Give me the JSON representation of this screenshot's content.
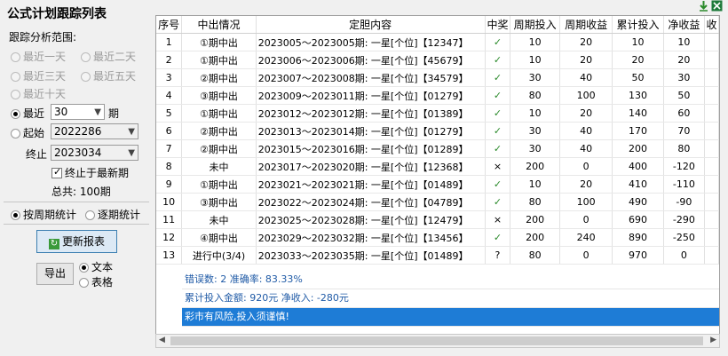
{
  "app": {
    "title": "公式计划跟踪列表"
  },
  "left": {
    "range_label": "跟踪分析范围:",
    "options": [
      "最近一天",
      "最近二天",
      "最近三天",
      "最近五天",
      "最近十天"
    ],
    "recent_label": "最近",
    "recent_value": "30",
    "recent_unit": "期",
    "start_label": "起始",
    "start_value": "2022286",
    "end_label": "终止",
    "end_value": "2023034",
    "end_latest_label": "终止于最新期",
    "total_label": "总共: 100期",
    "stat_by_period": "按周期统计",
    "stat_each": "逐期统计",
    "refresh_button": "更新报表",
    "export_button": "导出",
    "export_text": "文本",
    "export_table": "表格"
  },
  "table": {
    "headers": [
      "序号",
      "中出情况",
      "定胆内容",
      "中奖",
      "周期投入",
      "周期收益",
      "累计投入",
      "净收益",
      "收"
    ],
    "rows": [
      [
        "1",
        "①期中出",
        "2023005～2023005期: 一星[个位]【12347】",
        "hit",
        "10",
        "20",
        "10",
        "10"
      ],
      [
        "2",
        "①期中出",
        "2023006～2023006期: 一星[个位]【45679】",
        "hit",
        "10",
        "20",
        "20",
        "20"
      ],
      [
        "3",
        "②期中出",
        "2023007～2023008期: 一星[个位]【34579】",
        "hit",
        "30",
        "40",
        "50",
        "30"
      ],
      [
        "4",
        "③期中出",
        "2023009～2023011期: 一星[个位]【01279】",
        "hit",
        "80",
        "100",
        "130",
        "50"
      ],
      [
        "5",
        "①期中出",
        "2023012～2023012期: 一星[个位]【01389】",
        "hit",
        "10",
        "20",
        "140",
        "60"
      ],
      [
        "6",
        "②期中出",
        "2023013～2023014期: 一星[个位]【01279】",
        "hit",
        "30",
        "40",
        "170",
        "70"
      ],
      [
        "7",
        "②期中出",
        "2023015～2023016期: 一星[个位]【01289】",
        "hit",
        "30",
        "40",
        "200",
        "80"
      ],
      [
        "8",
        "未中",
        "2023017～2023020期: 一星[个位]【12368】",
        "miss",
        "200",
        "0",
        "400",
        "-120"
      ],
      [
        "9",
        "①期中出",
        "2023021～2023021期: 一星[个位]【01489】",
        "hit",
        "10",
        "20",
        "410",
        "-110"
      ],
      [
        "10",
        "③期中出",
        "2023022～2023024期: 一星[个位]【04789】",
        "hit",
        "80",
        "100",
        "490",
        "-90"
      ],
      [
        "11",
        "未中",
        "2023025～2023028期: 一星[个位]【12479】",
        "miss",
        "200",
        "0",
        "690",
        "-290"
      ],
      [
        "12",
        "④期中出",
        "2023029～2023032期: 一星[个位]【13456】",
        "hit",
        "200",
        "240",
        "890",
        "-250"
      ],
      [
        "13",
        "进行中(3/4)",
        "2023033～2023035期: 一星[个位]【01489】",
        "pending",
        "80",
        "0",
        "970",
        "0"
      ]
    ],
    "marks": {
      "hit": "✓",
      "miss": "×",
      "pending": "?"
    }
  },
  "summary": {
    "line1": "错误数: 2  准确率: 83.33%",
    "line2": "累计投入金额: 920元  净收入: -280元",
    "line3": "彩市有风险,投入须谨慎!"
  },
  "colors": {
    "accent": "#1e7cd6",
    "summary_text": "#1f5aa6",
    "hit": "#2a8a2a"
  }
}
